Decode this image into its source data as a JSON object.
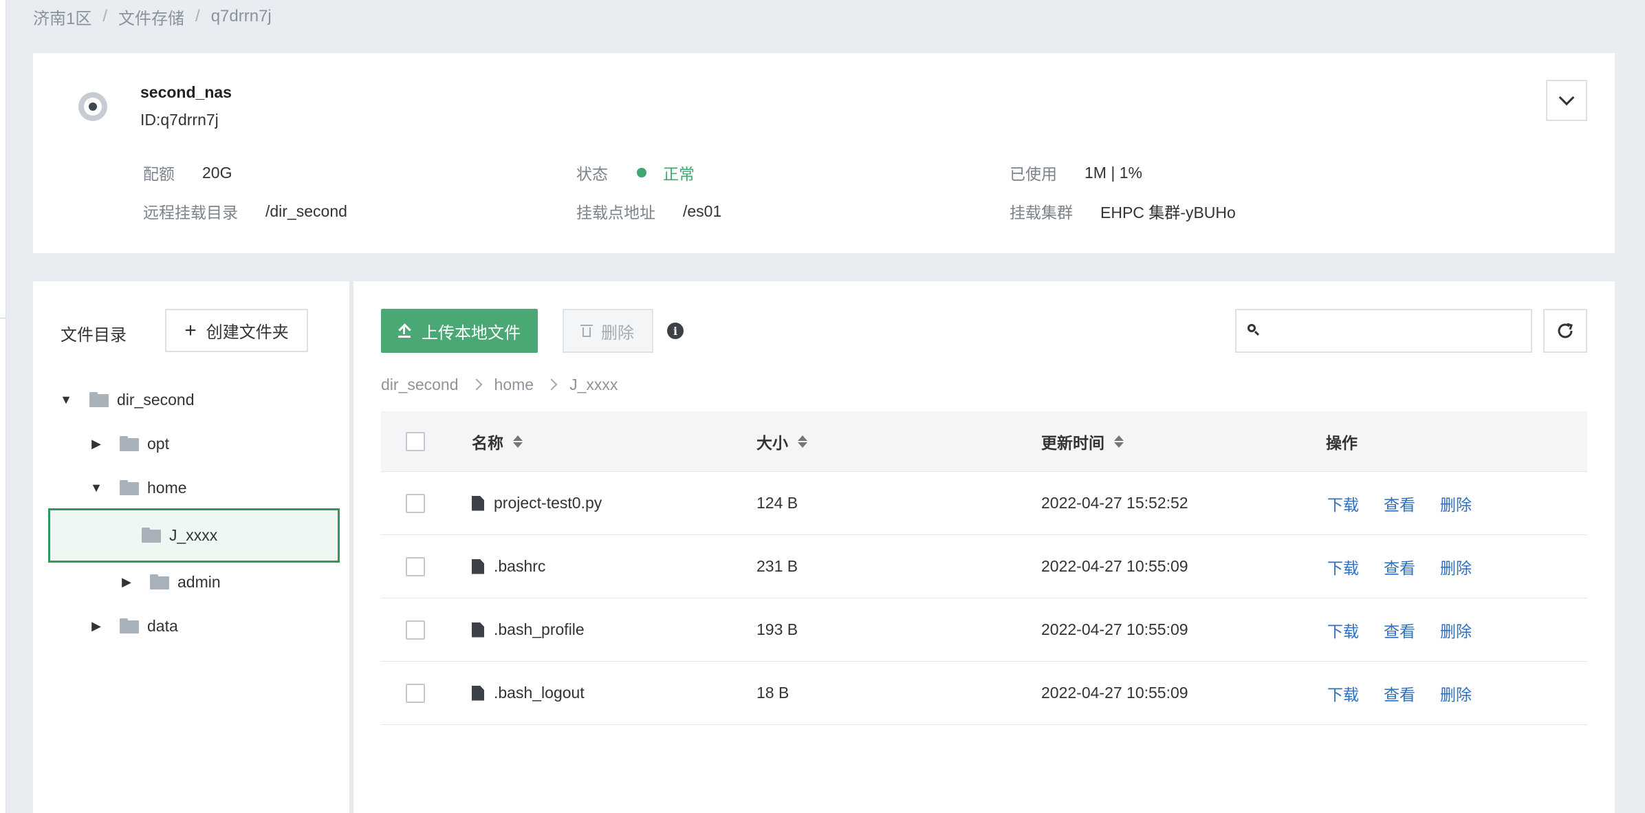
{
  "breadcrumb": [
    "济南1区",
    "文件存储",
    "q7drrn7j"
  ],
  "breadcrumb_sep": "/",
  "nas": {
    "name": "second_nas",
    "id": "ID:q7drrn7j",
    "quota_label": "配额",
    "quota_value": "20G",
    "status_label": "状态",
    "status_value": "正常",
    "used_label": "已使用",
    "used_value": "1M | 1%",
    "remote_dir_label": "远程挂载目录",
    "remote_dir_value": "/dir_second",
    "mount_addr_label": "挂载点地址",
    "mount_addr_value": "/es01",
    "cluster_label": "挂载集群",
    "cluster_value": "EHPC 集群-yBUHo",
    "status_color": "#3fa76f"
  },
  "tree": {
    "title": "文件目录",
    "new_folder_label": "创建文件夹",
    "nodes": [
      {
        "label": "dir_second",
        "arrow": "▼"
      },
      {
        "label": "opt",
        "arrow": "▶"
      },
      {
        "label": "home",
        "arrow": "▼"
      },
      {
        "label": "J_xxxx",
        "arrow": ""
      },
      {
        "label": "admin",
        "arrow": "▶"
      },
      {
        "label": "data",
        "arrow": "▶"
      }
    ]
  },
  "toolbar": {
    "upload_label": "上传本地文件",
    "delete_label": "删除",
    "search_placeholder": "",
    "accent_color": "#4aa874"
  },
  "path": [
    "dir_second",
    "home",
    "J_xxxx"
  ],
  "table": {
    "headers": {
      "name": "名称",
      "size": "大小",
      "updated": "更新时间",
      "actions": "操作"
    },
    "rows": [
      {
        "name": "project-test0.py",
        "size": "124 B",
        "updated": "2022-04-27 15:52:52"
      },
      {
        "name": ".bashrc",
        "size": "231 B",
        "updated": "2022-04-27 10:55:09"
      },
      {
        "name": ".bash_profile",
        "size": "193 B",
        "updated": "2022-04-27 10:55:09"
      },
      {
        "name": ".bash_logout",
        "size": "18 B",
        "updated": "2022-04-27 10:55:09"
      }
    ],
    "action_labels": {
      "download": "下载",
      "view": "查看",
      "delete": "删除"
    },
    "link_color": "#2f6fbd"
  }
}
